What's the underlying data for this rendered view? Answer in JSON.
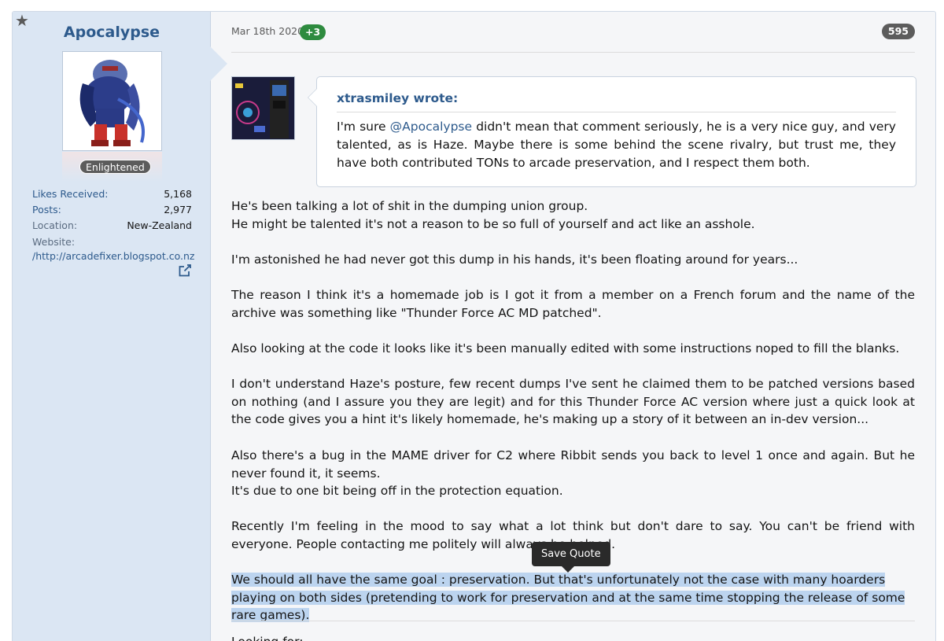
{
  "user": {
    "name": "Apocalypse",
    "title": "Enlightened",
    "stats": {
      "likes_label": "Likes Received:",
      "likes_value": "5,168",
      "posts_label": "Posts:",
      "posts_value": "2,977",
      "location_label": "Location:",
      "location_value": "New-Zealand",
      "website_label": "Website:",
      "website_value": "http://arcadefixer.blogspot.co.nz/"
    }
  },
  "post": {
    "date": "Mar 18th 2020",
    "reaction": "+3",
    "number": "595"
  },
  "quote": {
    "author": "xtrasmiley wrote:",
    "pre": "I'm sure ",
    "mention": "@Apocalypse",
    "post": " didn't mean that comment seriously, he is a very nice guy, and very talented, as is Haze. Maybe there is some behind the scene rivalry, but trust me, they have both contributed TONs to arcade preservation, and I respect them both."
  },
  "body": {
    "p1_l1": "He's been talking a lot of shit in the dumping union group.",
    "p1_l2": "He might be talented it's not a reason to be so full of yourself and act like an asshole.",
    "p2": "I'm astonished he had never got this dump in his hands, it's been floating around for years...",
    "p3": "The reason I think it's a homemade job is I got it from a member on a French forum and the name of the archive was something like \"Thunder Force AC MD patched\".",
    "p4": "Also looking at the code it looks like it's been manually edited with some instructions noped to fill the blanks.",
    "p5": "I don't understand Haze's posture, few recent dumps I've sent he claimed them to be patched versions based on nothing (and I assure you they are legit) and for this Thunder Force AC version where just a quick look at the code gives you a hint it's likely homemade, he's making up a story of it between an in-dev version...",
    "p6_l1": "Also there's a bug in the MAME driver for C2 where Ribbit sends you back to level 1 once and again. But he never found it, it seems.",
    "p6_l2": "It's due to one bit being off in the protection equation.",
    "p7": "Recently I'm feeling in the mood to say what a lot think but don't dare to say. You can't be friend with everyone. People contacting me politely will always be helped.",
    "p8": "We should all have the same goal : preservation. But that's unfortunately not the case with many hoarders playing on both sides (pretending to work for preservation and at the same time stopping the release of some rare games)."
  },
  "tooltip": {
    "label": "Save Quote"
  },
  "signature": {
    "text": "Looking for:"
  },
  "icons": {
    "star": "star-icon",
    "external": "external-link-icon"
  },
  "colors": {
    "link": "#2d5a8c",
    "reaction": "#2e8b3f",
    "highlight": "#bcd4ef",
    "sidebar": "#dbe6f3"
  }
}
